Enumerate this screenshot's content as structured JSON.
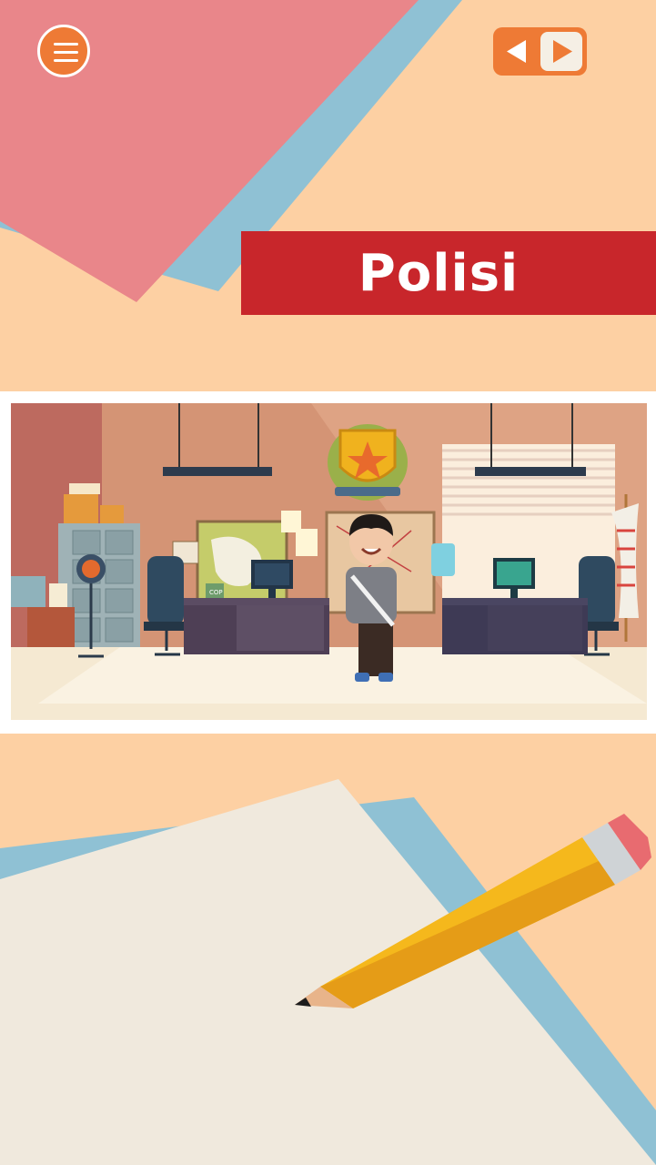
{
  "header": {
    "menu_icon": "hamburger-menu-icon",
    "nav": {
      "prev_icon": "triangle-left-icon",
      "next_icon": "triangle-right-icon"
    }
  },
  "title": {
    "text": "Polisi"
  },
  "scene": {
    "badge_text": "COP",
    "description_items": [
      "police-officer",
      "office-desk",
      "computer-monitor",
      "filing-cabinet",
      "star-badge-emblem",
      "window-blinds",
      "flag",
      "water-cooler",
      "desk-fan",
      "office-chair"
    ]
  },
  "drawing_area": {
    "pencil_icon": "pencil-icon"
  },
  "colors": {
    "background_peach": "#fdd0a3",
    "paper_pink": "#e9868a",
    "paper_blue": "#8fc1d4",
    "banner_red": "#c8262b",
    "accent_orange": "#ee7a35",
    "paper_cream": "#f0e9dd",
    "pencil_yellow": "#f5b81c"
  }
}
